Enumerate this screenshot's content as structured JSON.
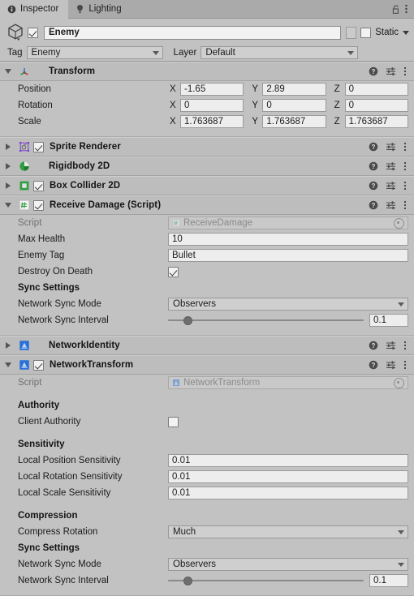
{
  "window": {
    "tabs": [
      {
        "label": "Inspector",
        "icon": "info-icon",
        "active": true
      },
      {
        "label": "Lighting",
        "icon": "lightbulb-icon",
        "active": false
      }
    ],
    "lock_icon": "lock-open-icon",
    "menu_icon": "kebab-menu-icon"
  },
  "gameobject": {
    "icon": "cube-icon",
    "enabled": true,
    "name": "Enemy",
    "static_label": "Static",
    "static_checked": false,
    "tag_label": "Tag",
    "tag_value": "Enemy",
    "layer_label": "Layer",
    "layer_value": "Default"
  },
  "header_actions": {
    "help": "help-icon",
    "preset": "preset-icon",
    "menu": "kebab-menu-icon"
  },
  "components": [
    {
      "id": "transform",
      "title": "Transform",
      "icon": "transform-axis-icon",
      "expanded": true,
      "has_enable_checkbox": false,
      "rows": [
        {
          "type": "vector3",
          "label": "Position",
          "axes": [
            "X",
            "Y",
            "Z"
          ],
          "values": [
            "-1.65",
            "2.89",
            "0"
          ]
        },
        {
          "type": "vector3",
          "label": "Rotation",
          "axes": [
            "X",
            "Y",
            "Z"
          ],
          "values": [
            "0",
            "0",
            "0"
          ]
        },
        {
          "type": "vector3",
          "label": "Scale",
          "axes": [
            "X",
            "Y",
            "Z"
          ],
          "values": [
            "1.763687",
            "1.763687",
            "1.763687"
          ]
        }
      ]
    },
    {
      "id": "sprite-renderer",
      "title": "Sprite Renderer",
      "icon": "sprite-renderer-icon",
      "expanded": false,
      "has_enable_checkbox": true,
      "enabled": true,
      "rows": []
    },
    {
      "id": "rigidbody-2d",
      "title": "Rigidbody 2D",
      "icon": "rigidbody-2d-icon",
      "expanded": false,
      "has_enable_checkbox": false,
      "rows": []
    },
    {
      "id": "box-collider-2d",
      "title": "Box Collider 2D",
      "icon": "box-collider-2d-icon",
      "expanded": false,
      "has_enable_checkbox": true,
      "enabled": true,
      "rows": []
    },
    {
      "id": "receive-damage",
      "title": "Receive Damage (Script)",
      "icon": "csharp-script-icon",
      "expanded": true,
      "has_enable_checkbox": true,
      "enabled": true,
      "rows": [
        {
          "type": "object",
          "label": "Script",
          "value": "ReceiveDamage",
          "icon": "csharp-script-icon",
          "readonly": true
        },
        {
          "type": "text",
          "label": "Max Health",
          "value": "10"
        },
        {
          "type": "text",
          "label": "Enemy Tag",
          "value": "Bullet"
        },
        {
          "type": "checkbox",
          "label": "Destroy On Death",
          "checked": true
        },
        {
          "type": "group",
          "label": "Sync Settings"
        },
        {
          "type": "dropdown",
          "label": "Network Sync Mode",
          "value": "Observers"
        },
        {
          "type": "slider",
          "label": "Network Sync Interval",
          "value": "0.1",
          "knob_pct": 8
        }
      ]
    },
    {
      "id": "network-identity",
      "title": "NetworkIdentity",
      "icon": "mirror-network-icon",
      "expanded": false,
      "has_enable_checkbox": false,
      "rows": []
    },
    {
      "id": "network-transform",
      "title": "NetworkTransform",
      "icon": "mirror-network-icon",
      "expanded": true,
      "has_enable_checkbox": true,
      "enabled": true,
      "rows": [
        {
          "type": "object",
          "label": "Script",
          "value": "NetworkTransform",
          "icon": "mirror-network-icon",
          "readonly": true
        },
        {
          "type": "spacer"
        },
        {
          "type": "group",
          "label": "Authority"
        },
        {
          "type": "checkbox",
          "label": "Client Authority",
          "checked": false
        },
        {
          "type": "spacer"
        },
        {
          "type": "group",
          "label": "Sensitivity"
        },
        {
          "type": "text",
          "label": "Local Position Sensitivity",
          "value": "0.01"
        },
        {
          "type": "text",
          "label": "Local Rotation Sensitivity",
          "value": "0.01"
        },
        {
          "type": "text",
          "label": "Local Scale Sensitivity",
          "value": "0.01"
        },
        {
          "type": "spacer"
        },
        {
          "type": "group",
          "label": "Compression"
        },
        {
          "type": "dropdown",
          "label": "Compress Rotation",
          "value": "Much"
        },
        {
          "type": "group",
          "label": "Sync Settings"
        },
        {
          "type": "dropdown",
          "label": "Network Sync Mode",
          "value": "Observers"
        },
        {
          "type": "slider",
          "label": "Network Sync Interval",
          "value": "0.1",
          "knob_pct": 8
        }
      ]
    }
  ],
  "colors": {
    "panel_bg": "#c2c2c2",
    "header_bg": "#bdbdbd",
    "tabbar_bg": "#aaaaaa",
    "field_bg": "#ededed",
    "accent_green": "#2f9e41",
    "accent_blue": "#2a6fd6"
  }
}
